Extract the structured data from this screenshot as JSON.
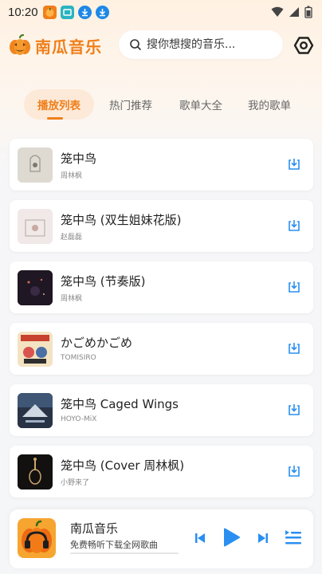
{
  "status_bar": {
    "time": "10:20"
  },
  "header": {
    "app_title": "南瓜音乐",
    "search_placeholder": "搜你想搜的音乐..."
  },
  "tabs": [
    {
      "label": "播放列表",
      "active": true
    },
    {
      "label": "热门推荐",
      "active": false
    },
    {
      "label": "歌单大全",
      "active": false
    },
    {
      "label": "我的歌单",
      "active": false
    }
  ],
  "songs": [
    {
      "title": "笼中鸟",
      "artist": "周林枫"
    },
    {
      "title": "笼中鸟 (双生姐妹花版)",
      "artist": "赵磊磊"
    },
    {
      "title": "笼中鸟 (节奏版)",
      "artist": "周林枫"
    },
    {
      "title": "かごめかごめ",
      "artist": "TOMISIRO"
    },
    {
      "title": "笼中鸟 Caged Wings",
      "artist": "HOYO-MiX"
    },
    {
      "title": "笼中鸟 (Cover 周林枫)",
      "artist": "小野来了"
    }
  ],
  "player": {
    "title": "南瓜音乐",
    "subtitle": "免费畅听下载全网歌曲"
  },
  "colors": {
    "accent": "#f07f1a",
    "control_blue": "#2a8ff0"
  }
}
